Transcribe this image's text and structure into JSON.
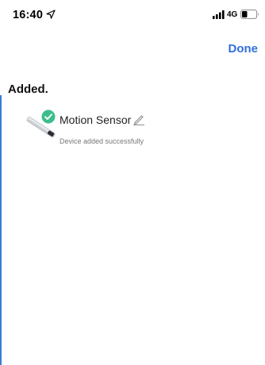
{
  "status_bar": {
    "time": "16:40",
    "network": "4G"
  },
  "header": {
    "done_label": "Done"
  },
  "main": {
    "heading": "Added.",
    "device": {
      "name": "Motion Sensor",
      "status": "Device added successfully"
    }
  },
  "icons": {
    "location": "location-arrow-icon",
    "signal": "cellular-signal-icon",
    "battery": "battery-icon",
    "success": "check-circle-icon",
    "edit": "pencil-icon"
  },
  "colors": {
    "accent": "#2f6fde",
    "success": "#3dbd8c",
    "muted_text": "#777777"
  }
}
